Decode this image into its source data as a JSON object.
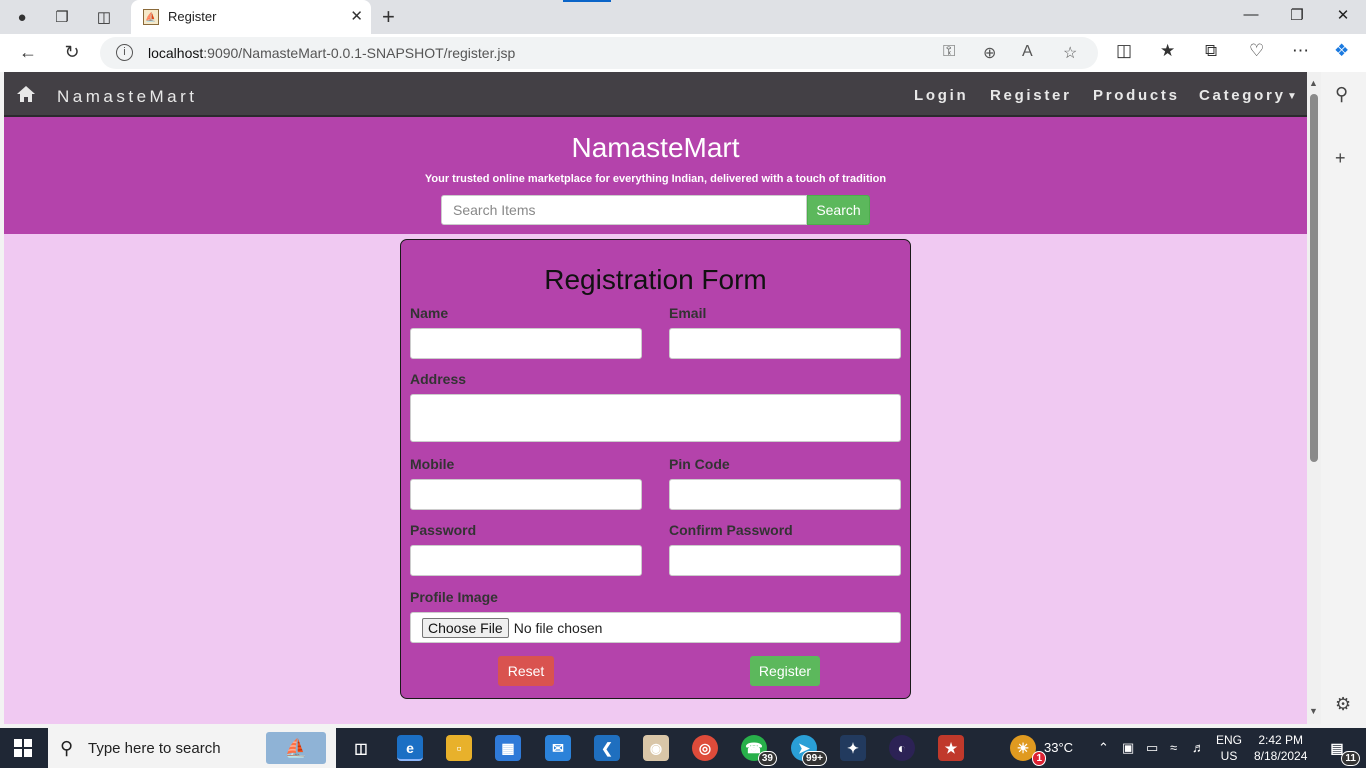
{
  "browser": {
    "tab_title": "Register",
    "url_host": "localhost",
    "url_rest": ":9090/NamasteMart-0.0.1-SNAPSHOT/register.jsp"
  },
  "navbar": {
    "brand": "NamasteMart",
    "links": [
      "Login",
      "Register",
      "Products",
      "Category"
    ]
  },
  "hero": {
    "title": "NamasteMart",
    "tagline": "Your trusted online marketplace for everything Indian, delivered with a touch of tradition",
    "search_placeholder": "Search Items",
    "search_button": "Search"
  },
  "form": {
    "title": "Registration Form",
    "labels": {
      "name": "Name",
      "email": "Email",
      "address": "Address",
      "mobile": "Mobile",
      "pincode": "Pin Code",
      "password": "Password",
      "confirm_password": "Confirm Password",
      "profile_image": "Profile Image"
    },
    "file_button": "Choose File",
    "file_status": "No file chosen",
    "reset_button": "Reset",
    "register_button": "Register"
  },
  "taskbar": {
    "search_placeholder": "Type here to search",
    "badges": {
      "whatsapp": "39",
      "telegram": "99+"
    },
    "weather_temp": "33°C",
    "weather_badge": "1",
    "lang_line1": "ENG",
    "lang_line2": "US",
    "time": "2:42 PM",
    "date": "8/18/2024",
    "notification_count": "11"
  }
}
